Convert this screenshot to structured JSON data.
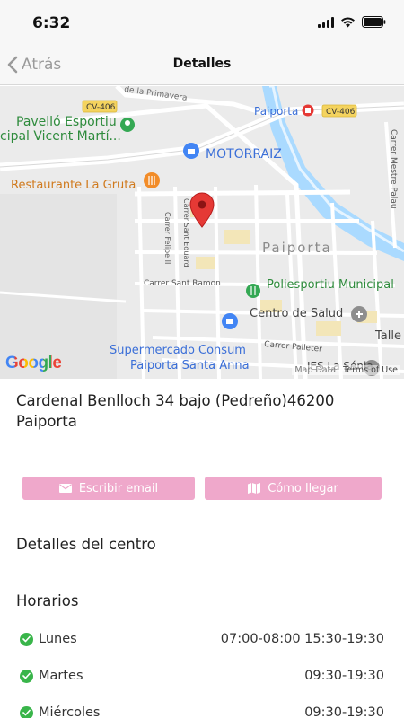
{
  "status_bar": {
    "time": "6:32"
  },
  "nav": {
    "back_label": "Atrás",
    "title": "Detalles"
  },
  "map": {
    "labels": {
      "cv406_left": "CV-406",
      "cv406_right": "CV-406",
      "primavera": "de la Primavera",
      "pavello_1": "Pavelló Esportiu",
      "pavello_2": "cipal Vicent Martí...",
      "motorraiz": "MOTORRAIZ",
      "paiporta_station": "Paiporta",
      "restaurante": "Restaurante La Gruta",
      "carrer_mestre_palau": "Carrer Mestre Palau",
      "carrer_sant_eduard": "Carrer Sant Eduard",
      "carrer_felipe": "Carrer Felipe II",
      "paiporta_town": "Paiporta",
      "carrer_sant_ramon": "Carrer Sant Ramon",
      "poliesportiu": "Poliesportiu Municipal",
      "centro_salud": "Centro de Salud",
      "talle": "Talle",
      "carrer_palleter": "Carrer Palleter",
      "super_1": "Supermercado Consum",
      "super_2": "Paiporta Santa Anna",
      "ies": "IES La Sénia",
      "map_data": "Map Data",
      "terms": "Terms of Use",
      "google": "Google"
    }
  },
  "location": {
    "address": "Cardenal Benlloch 34 bajo (Pedreño)46200 Paiporta"
  },
  "actions": {
    "email_label": "Escribir email",
    "route_label": "Cómo llegar"
  },
  "sections": {
    "details_title": "Detalles del centro",
    "hours_title": "Horarios"
  },
  "schedule": [
    {
      "day": "Lunes",
      "hours": "07:00-08:00 15:30-19:30"
    },
    {
      "day": "Martes",
      "hours": "09:30-19:30"
    },
    {
      "day": "Miércoles",
      "hours": "09:30-19:30"
    }
  ],
  "colors": {
    "accent_pink": "#efa8cb",
    "check_green": "#39b54a",
    "pin_red": "#e53935",
    "water": "#aadaff"
  }
}
